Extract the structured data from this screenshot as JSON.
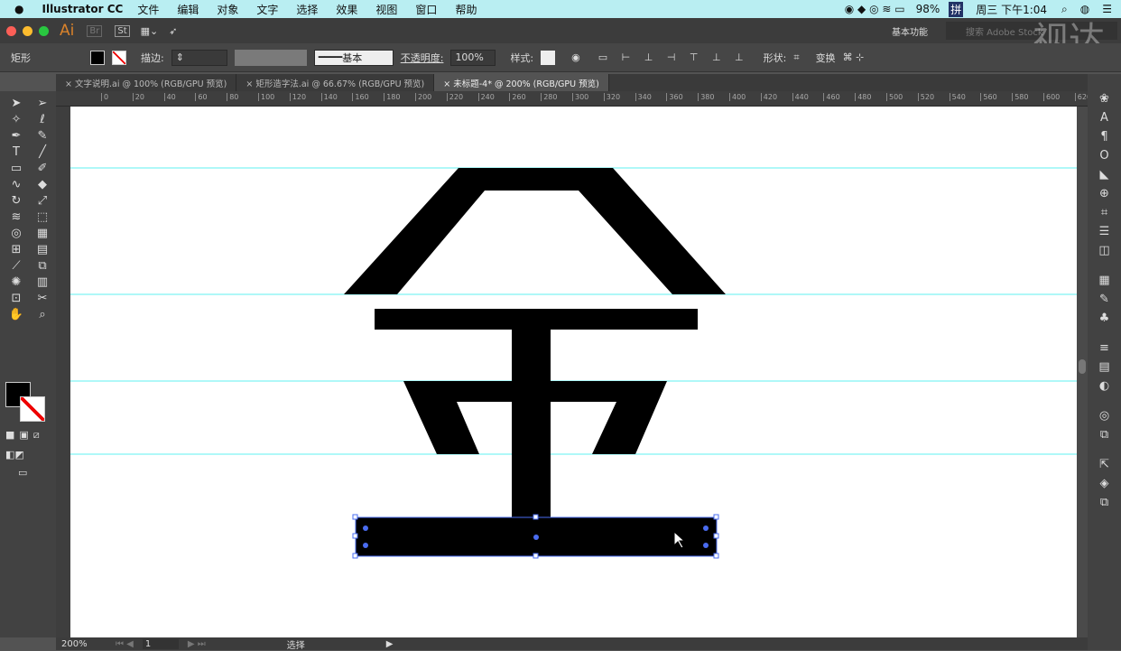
{
  "menubar": {
    "apple": "",
    "app": "Illustrator CC",
    "items": [
      "文件",
      "编辑",
      "对象",
      "文字",
      "选择",
      "效果",
      "视图",
      "窗口",
      "帮助"
    ],
    "battery": "98%",
    "ime": "拼",
    "clock": "周三 下午1:04"
  },
  "titlebar": {
    "logo": "Ai",
    "br": "Br",
    "st": "St",
    "workspace": "基本功能",
    "search_placeholder": "搜索 Adobe Stock",
    "watermark": "视达"
  },
  "control": {
    "object_type": "矩形",
    "stroke_label": "描边:",
    "style_line": "基本",
    "opacity_label": "不透明度:",
    "opacity": "100%",
    "style_label": "样式:",
    "shape_label": "形状:",
    "transform_label": "变换"
  },
  "tabs": [
    {
      "label": "文字说明.ai @ 100% (RGB/GPU 预览)"
    },
    {
      "label": "矩形造字法.ai @ 66.67% (RGB/GPU 预览)"
    },
    {
      "label": "未标题-4* @ 200% (RGB/GPU 预览)",
      "active": true
    }
  ],
  "ruler": [
    "0",
    "20",
    "40",
    "60",
    "80",
    "100",
    "120",
    "140",
    "160",
    "180",
    "200",
    "220",
    "240",
    "260",
    "280",
    "300",
    "320",
    "340",
    "360",
    "380",
    "400",
    "420",
    "440",
    "460",
    "480",
    "500",
    "520",
    "540",
    "560",
    "580",
    "600",
    "620",
    "640"
  ],
  "status": {
    "zoom": "200%",
    "page": "1",
    "tool": "选择"
  },
  "colors": {
    "guide": "#5ff0f0",
    "selection": "#4a6cf0",
    "fill": "#000000"
  }
}
